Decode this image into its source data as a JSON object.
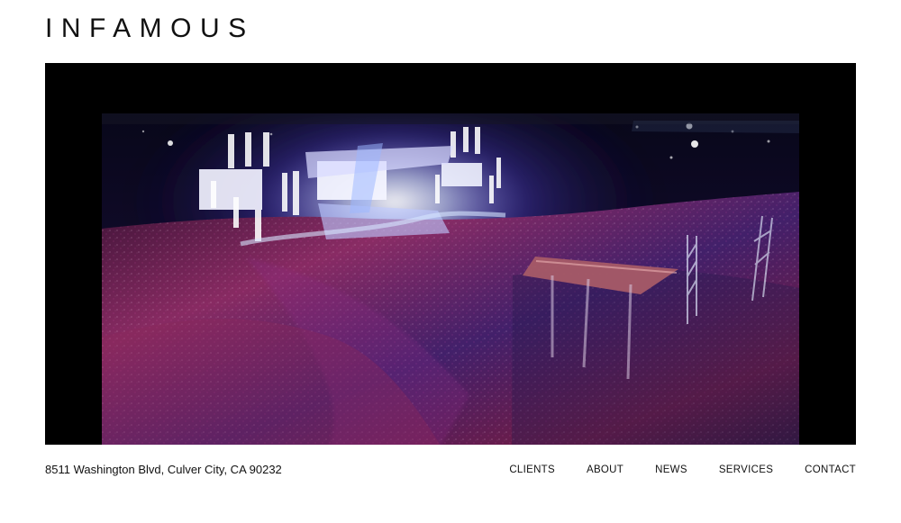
{
  "header": {
    "logo_text": "INFAMOUS"
  },
  "hero": {
    "media_name": "concert-video",
    "scene": "night festival crowd aerial"
  },
  "footer": {
    "address": "8511 Washington Blvd, Culver City, CA 90232"
  },
  "nav": {
    "items": [
      {
        "label": "CLIENTS"
      },
      {
        "label": "ABOUT"
      },
      {
        "label": "NEWS"
      },
      {
        "label": "SERVICES"
      },
      {
        "label": "CONTACT"
      }
    ]
  },
  "colors": {
    "background": "#ffffff",
    "text": "#111111",
    "video_frame": "#000000"
  }
}
